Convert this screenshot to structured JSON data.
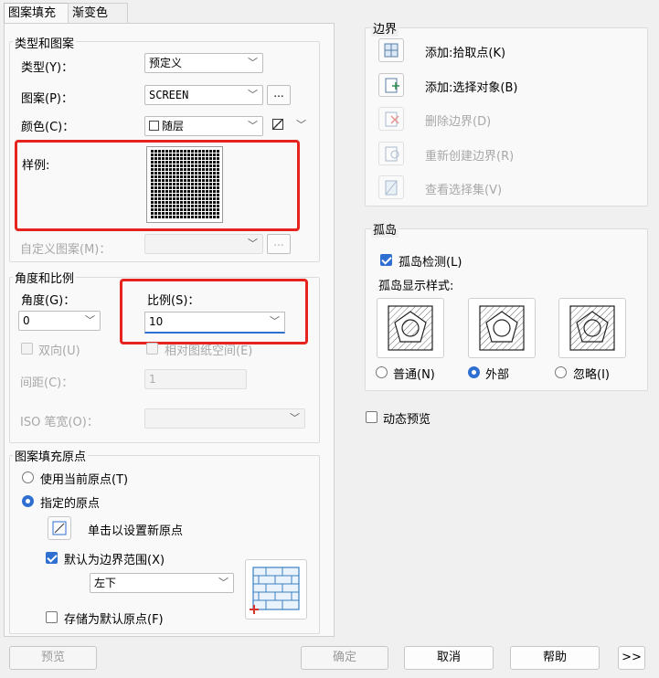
{
  "tabs": [
    "图案填充",
    "渐变色"
  ],
  "type_pattern": {
    "title": "类型和图案",
    "type_label": "类型(Y)：",
    "type_value": "预定义",
    "pattern_label": "图案(P)：",
    "pattern_value": "SCREEN",
    "browse": "...",
    "color_label": "颜色(C)：",
    "color_value": "随层",
    "sample_label": "样例:",
    "custom_label": "自定义图案(M)：",
    "custom_browse": "..."
  },
  "angle_scale": {
    "title": "角度和比例",
    "angle_label": "角度(G)：",
    "angle_value": "0",
    "scale_label": "比例(S)：",
    "scale_value": "10",
    "double_label": "双向(U)",
    "relative_label": "相对图纸空间(E)",
    "spacing_label": "间距(C)：",
    "spacing_value": "1",
    "iso_label": "ISO 笔宽(O)："
  },
  "origin": {
    "title": "图案填充原点",
    "use_current": "使用当前原点(T)",
    "specified": "指定的原点",
    "click_set": "单击以设置新原点",
    "default_boundary": "默认为边界范围(X)",
    "position_value": "左下",
    "store_default": "存储为默认原点(F)"
  },
  "boundary": {
    "title": "边界",
    "add_pick": "添加:拾取点(K)",
    "add_select": "添加:选择对象(B)",
    "remove": "删除边界(D)",
    "recreate": "重新创建边界(R)",
    "view_set": "查看选择集(V)"
  },
  "island": {
    "title": "孤岛",
    "detect": "孤岛检测(L)",
    "style_label": "孤岛显示样式:",
    "normal": "普通(N)",
    "outer": "外部",
    "ignore": "忽略(I)"
  },
  "dynamic_preview": "动态预览",
  "footer": {
    "preview": "预览",
    "ok": "确定",
    "cancel": "取消",
    "help": "帮助",
    "more": ">>"
  },
  "colors": {
    "accent": "#2e6fd1",
    "highlight": "#e6231f"
  }
}
